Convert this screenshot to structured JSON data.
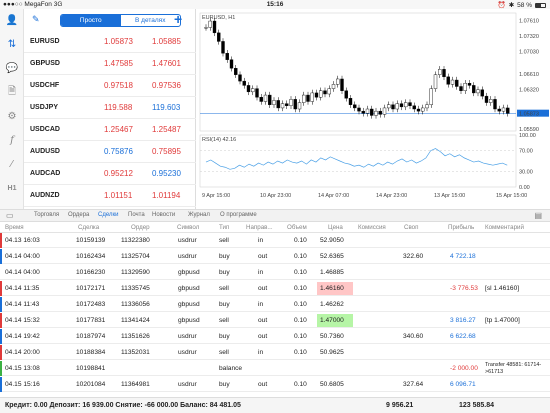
{
  "status_bar": {
    "carrier": "●●●○○ MegaFon  3G",
    "time": "15:16",
    "battery_text": "58 %",
    "battery_level": 0.58
  },
  "quotes_header": {
    "simple_tab": "Просто",
    "detailed_tab": "В деталях"
  },
  "quotes": [
    {
      "symbol": "EURUSD",
      "bid": "1.05873",
      "ask": "1.05885",
      "bid_color": "red",
      "ask_color": "red"
    },
    {
      "symbol": "GBPUSD",
      "bid": "1.47585",
      "ask": "1.47601",
      "bid_color": "red",
      "ask_color": "red"
    },
    {
      "symbol": "USDCHF",
      "bid": "0.97518",
      "ask": "0.97536",
      "bid_color": "red",
      "ask_color": "red"
    },
    {
      "symbol": "USDJPY",
      "bid": "119.588",
      "ask": "119.603",
      "bid_color": "red",
      "ask_color": "blue"
    },
    {
      "symbol": "USDCAD",
      "bid": "1.25467",
      "ask": "1.25487",
      "bid_color": "red",
      "ask_color": "red"
    },
    {
      "symbol": "AUDUSD",
      "bid": "0.75876",
      "ask": "0.75895",
      "bid_color": "blue",
      "ask_color": "red"
    },
    {
      "symbol": "AUDCAD",
      "bid": "0.95212",
      "ask": "0.95230",
      "bid_color": "red",
      "ask_color": "blue"
    },
    {
      "symbol": "AUDNZD",
      "bid": "1.01151",
      "ask": "1.01194",
      "bid_color": "red",
      "ask_color": "red"
    }
  ],
  "chart": {
    "title": "EURUSD, H1",
    "rsi_label": "RSI(14) 42.16",
    "price_ticks": [
      "1.07610",
      "1.07320",
      "1.07030",
      "1.06610",
      "1.06320",
      "1.05873",
      "1.05590"
    ],
    "last_price": "1.05873",
    "rsi_ticks": [
      "100.00",
      "70.00",
      "30.00",
      "0.00"
    ],
    "time_ticks": [
      "9 Apr 15:00",
      "10 Apr 23:00",
      "14 Apr 07:00",
      "14 Apr 23:00",
      "13 Apr 15:00",
      "15 Apr 15:00"
    ]
  },
  "tabs": {
    "items": [
      "Торговля",
      "Ордера",
      "Сделки",
      "Почта",
      "Новости",
      "Журнал",
      "О программе"
    ],
    "active": "Сделки"
  },
  "deals_table": {
    "columns": [
      "Время",
      "Сделка",
      "Ордер",
      "Символ",
      "Тип",
      "Направ...",
      "Объем",
      "Цена",
      "Комиссия",
      "Своп",
      "Прибыль",
      "Комментарий"
    ],
    "rows": [
      {
        "time": "04.13 16:03",
        "deal": "10159139",
        "order": "11322380",
        "symbol": "usdrur",
        "type": "sell",
        "direction": "in",
        "volume": "0.10",
        "price": "52.9050",
        "commission": "",
        "swap": "",
        "profit": "",
        "comment": "",
        "mark": "red"
      },
      {
        "time": "04.14 04:00",
        "deal": "10162434",
        "order": "11325704",
        "symbol": "usdrur",
        "type": "buy",
        "direction": "out",
        "volume": "0.10",
        "price": "52.6365",
        "commission": "",
        "swap": "322.60",
        "profit": "4 722.18",
        "comment": "",
        "mark": "blue"
      },
      {
        "time": "04.14 04:00",
        "deal": "10166230",
        "order": "11329590",
        "symbol": "gbpusd",
        "type": "buy",
        "direction": "in",
        "volume": "0.10",
        "price": "1.46885",
        "commission": "",
        "swap": "",
        "profit": "",
        "comment": "",
        "mark": ""
      },
      {
        "time": "04.14 11:35",
        "deal": "10172171",
        "order": "11335745",
        "symbol": "gbpusd",
        "type": "sell",
        "direction": "out",
        "volume": "0.10",
        "price": "1.46160",
        "commission": "",
        "swap": "",
        "profit": "-3 776.53",
        "comment": "[sl 1.46160]",
        "mark": "red",
        "price_bg": "red"
      },
      {
        "time": "04.14 11:43",
        "deal": "10172483",
        "order": "11336056",
        "symbol": "gbpusd",
        "type": "buy",
        "direction": "in",
        "volume": "0.10",
        "price": "1.46262",
        "commission": "",
        "swap": "",
        "profit": "",
        "comment": "",
        "mark": "blue"
      },
      {
        "time": "04.14 15:32",
        "deal": "10177831",
        "order": "11341424",
        "symbol": "gbpusd",
        "type": "sell",
        "direction": "out",
        "volume": "0.10",
        "price": "1.47000",
        "commission": "",
        "swap": "",
        "profit": "3 816.27",
        "comment": "[tp 1.47000]",
        "mark": "red",
        "price_bg": "green"
      },
      {
        "time": "04.14 19:42",
        "deal": "10187974",
        "order": "11351626",
        "symbol": "usdrur",
        "type": "buy",
        "direction": "out",
        "volume": "0.10",
        "price": "50.7360",
        "commission": "",
        "swap": "340.60",
        "profit": "6 622.68",
        "comment": "",
        "mark": "blue"
      },
      {
        "time": "04.14 20:00",
        "deal": "10188384",
        "order": "11352031",
        "symbol": "usdrur",
        "type": "sell",
        "direction": "in",
        "volume": "0.10",
        "price": "50.9625",
        "commission": "",
        "swap": "",
        "profit": "",
        "comment": "",
        "mark": "red"
      },
      {
        "time": "04.15 13:08",
        "deal": "10198841",
        "order": "",
        "symbol": "",
        "type": "balance",
        "direction": "",
        "volume": "",
        "price": "",
        "commission": "",
        "swap": "",
        "profit": "-2 000.00",
        "comment": "Transfer 48581: 61714->61713",
        "mark": "green"
      },
      {
        "time": "04.15 15:16",
        "deal": "10201084",
        "order": "11364981",
        "symbol": "usdrur",
        "type": "buy",
        "direction": "out",
        "volume": "0.10",
        "price": "50.6805",
        "commission": "",
        "swap": "327.64",
        "profit": "6 096.71",
        "comment": "",
        "mark": "blue"
      }
    ]
  },
  "footer": {
    "summary": "Кредит: 0.00 Депозит: 16 939.00 Снятие: -66 000.00 Баланс: 84 481.05",
    "swap_total": "9 956.21",
    "profit_total": "123 585.84"
  },
  "colors": {
    "accent": "#1a6fd8",
    "red": "#e03a3a",
    "green_hl": "#b6f5a6",
    "red_hl": "#ffc6c6"
  }
}
